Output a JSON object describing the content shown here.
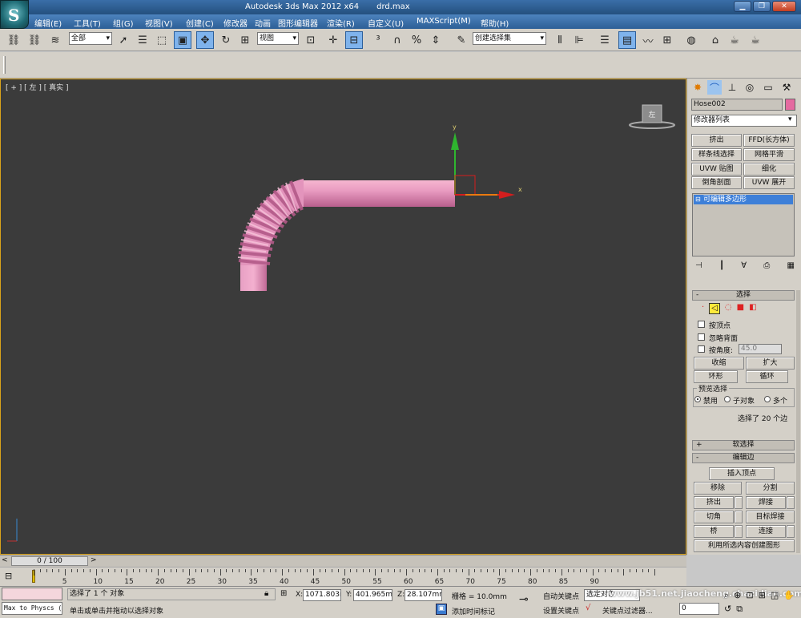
{
  "window": {
    "app_title": "Autodesk 3ds Max  2012 x64",
    "file_name": "drd.max"
  },
  "logo": {
    "glyph": "S"
  },
  "menu": [
    "编辑(E)",
    "工具(T)",
    "组(G)",
    "视图(V)",
    "创建(C)",
    "修改器",
    "动画",
    "图形编辑器",
    "渲染(R)",
    "自定义(U)",
    "MAXScript(M)",
    "帮助(H)"
  ],
  "toolbar": {
    "selection_filter": "全部",
    "ref_coord": "视图",
    "named_selection": "创建选择集"
  },
  "viewport": {
    "label": "[ + ] [ 左 ] [ 真实 ]",
    "viewcube_face": "左",
    "gizmo_x": "x",
    "gizmo_y": "y"
  },
  "command_panel": {
    "object_name": "Hose002",
    "object_color": "#e46aa0",
    "modifier_list": "修改器列表",
    "modifier_buttons": [
      "挤出",
      "FFD(长方体)",
      "样条线选择",
      "网格平滑",
      "UVW 贴图",
      "细化",
      "倒角剖面",
      "UVW 展开"
    ],
    "stack_item": "可编辑多边形",
    "selection": {
      "title": "选择",
      "by_vertex": "按顶点",
      "ignore_backfacing": "忽略背面",
      "by_angle": "按角度:",
      "angle_value": "45.0",
      "shrink": "收缩",
      "grow": "扩大",
      "ring": "环形",
      "loop": "循环",
      "preview_title": "预览选择",
      "preview_options": [
        "禁用",
        "子对象",
        "多个"
      ],
      "status": "选择了 20 个边"
    },
    "soft_selection": "软选择",
    "edit_edges": {
      "title": "编辑边",
      "insert_vertex": "插入顶点",
      "remove": "移除",
      "split": "分割",
      "extrude": "挤出",
      "weld": "焊接",
      "chamfer": "切角",
      "target_weld": "目标焊接",
      "bridge": "桥",
      "connect": "连接",
      "create_shape": "利用所选内容创建图形"
    }
  },
  "timeline": {
    "frame": "0 / 100",
    "ticks": [
      "5",
      "10",
      "15",
      "20",
      "25",
      "30",
      "35",
      "40",
      "45",
      "50",
      "55",
      "60",
      "65",
      "70",
      "75",
      "80",
      "85",
      "90"
    ]
  },
  "status": {
    "script_field": "Max to Physcs (",
    "selected": "选择了 1 个 对象",
    "prompt": "单击或单击并拖动以选择对象",
    "x_label": "X:",
    "x_value": "1071.803m",
    "y_label": "Y:",
    "y_value": "401.965m",
    "z_label": "Z:",
    "z_value": "28.107mm",
    "grid": "栅格 = 10.0mm",
    "add_time_tag": "添加时间标记",
    "auto_key": "自动关键点",
    "set_key": "设置关键点",
    "selected_object": "选定对象",
    "key_filters": "关键点过滤器...",
    "current_frame": "0",
    "watermark": "www.jb51.net.jiaocheng.chazidian.com"
  }
}
